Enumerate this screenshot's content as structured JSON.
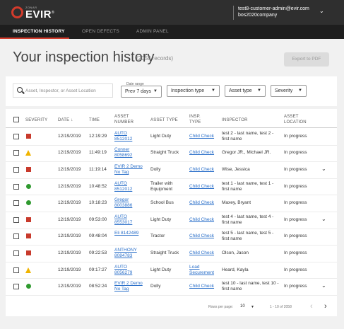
{
  "header": {
    "logo_small": "ZONAR",
    "logo_main": "EVIR",
    "logo_mark": "®",
    "user_email": "test8-customer-admin@evir.com",
    "user_company": "bos2020company",
    "caret_icon": "chevron-down-icon"
  },
  "nav": {
    "items": [
      {
        "label": "INSPECTION HISTORY",
        "active": true
      },
      {
        "label": "OPEN DEFECTS",
        "active": false
      },
      {
        "label": "ADMIN PANEL",
        "active": false
      }
    ]
  },
  "page": {
    "title": "Your inspection history",
    "count": "(2058 records)",
    "export_label": "Export to PDF"
  },
  "filters": {
    "search_placeholder": "Asset, Inspector, or Asset Location",
    "date_range_label": "Date range",
    "date_range_value": "Prev 7 days",
    "inspection_type": "Inspection type",
    "asset_type": "Asset type",
    "severity": "Severity"
  },
  "table": {
    "columns": [
      "SEVERITY",
      "DATE",
      "TIME",
      "ASSET NUMBER",
      "ASSET TYPE",
      "INSP. TYPE",
      "INSPECTOR",
      "ASSET LOCATION"
    ],
    "sort_indicator": "↓",
    "rows": [
      {
        "severity": "major",
        "date": "12/19/2019",
        "time": "12:19:29",
        "asset_number": "AUTO 8512012",
        "asset_type": "Light Duty",
        "insp_type": "Child Check",
        "inspector": "test 2 - last name, test 2 - first name",
        "location": "In progress",
        "expand": false
      },
      {
        "severity": "minor",
        "date": "12/19/2019",
        "time": "11:49:19",
        "asset_number": "Conner 8058692",
        "asset_type": "Straight Truck",
        "insp_type": "Child Check",
        "inspector": "Gregor JR., Michael JR.",
        "location": "In progress",
        "expand": false
      },
      {
        "severity": "major",
        "date": "12/19/2019",
        "time": "11:19:14",
        "asset_number": "EVIR 2 Demo No Tag",
        "asset_type": "Dolly",
        "insp_type": "Child Check",
        "inspector": "Wise, Jessica",
        "location": "In progress",
        "expand": true
      },
      {
        "severity": "none",
        "date": "12/19/2019",
        "time": "10:48:52",
        "asset_number": "AUTO 8512012",
        "asset_type": "Trailer with Equipment",
        "insp_type": "Child Check",
        "inspector": "test 1 - last name, test 1 - first name",
        "location": "In progress",
        "expand": false
      },
      {
        "severity": "none",
        "date": "12/19/2019",
        "time": "10:18:23",
        "asset_number": "Gregor 8003886",
        "asset_type": "School Bus",
        "insp_type": "Child Check",
        "inspector": "Maxey, Bryant",
        "location": "In progress",
        "expand": false
      },
      {
        "severity": "major",
        "date": "12/19/2019",
        "time": "09:53:00",
        "asset_number": "AUTO 8553017",
        "asset_type": "Light Duty",
        "insp_type": "Child Check",
        "inspector": "test 4 - last name, test 4 - first name",
        "location": "In progress",
        "expand": true
      },
      {
        "severity": "major",
        "date": "12/19/2019",
        "time": "09:48:04",
        "asset_number": "Eli 8142489",
        "asset_type": "Tractor",
        "insp_type": "Child Check",
        "inspector": "test 5 - last name, test 5 - first name",
        "location": "In progress",
        "expand": false
      },
      {
        "severity": "major",
        "date": "12/19/2019",
        "time": "09:22:53",
        "asset_number": "ANTHONY 8084783",
        "asset_type": "Straight Truck",
        "insp_type": "Child Check",
        "inspector": "Olson, Jason",
        "location": "In progress",
        "expand": false
      },
      {
        "severity": "minor",
        "date": "12/19/2019",
        "time": "09:17:27",
        "asset_number": "AUTO 8056279",
        "asset_type": "Light Duty",
        "insp_type": "Load Securement",
        "inspector": "Heard, Kayla",
        "location": "In progress",
        "expand": false
      },
      {
        "severity": "none",
        "date": "12/19/2019",
        "time": "08:52:24",
        "asset_number": "EVIR 2 Demo No Tag",
        "asset_type": "Dolly",
        "insp_type": "Child Check",
        "inspector": "test 10 - last name, test 10 - first name",
        "location": "In progress",
        "expand": true
      }
    ]
  },
  "pagination": {
    "rows_label": "Rows per page:",
    "rows_value": "10",
    "range": "1 - 10 of 2058",
    "prev_icon": "chevron-left-icon",
    "next_icon": "chevron-right-icon"
  },
  "colors": {
    "accent": "#d33b2c",
    "severity_major": "#c83a2c",
    "severity_minor": "#f0b400",
    "severity_none": "#2f9a2f",
    "link": "#2a6fc9"
  }
}
